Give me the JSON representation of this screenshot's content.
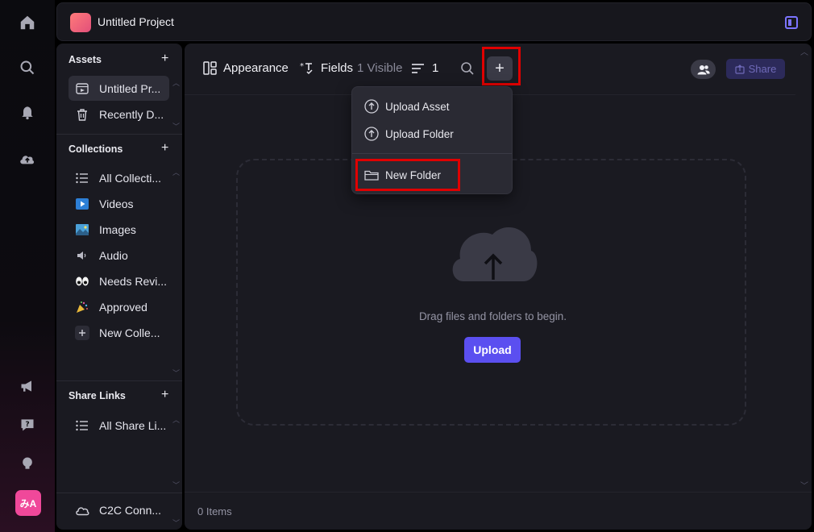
{
  "rail": {
    "icons": [
      "home-icon",
      "search-icon",
      "bell-icon",
      "cloud-upload-icon",
      "megaphone-icon",
      "help-icon",
      "lightbulb-icon"
    ],
    "avatar_text": "みA"
  },
  "topbar": {
    "project_title": "Untitled Project"
  },
  "sidebar": {
    "assets": {
      "heading": "Assets",
      "add": "+",
      "items": [
        {
          "label": "Untitled Pr...",
          "icon": "project-icon",
          "active": true
        },
        {
          "label": "Recently D...",
          "icon": "trash-icon"
        }
      ]
    },
    "collections": {
      "heading": "Collections",
      "add": "+",
      "items": [
        {
          "label": "All Collecti...",
          "icon": "list-icon"
        },
        {
          "label": "Videos",
          "icon": "video-icon"
        },
        {
          "label": "Images",
          "icon": "image-icon"
        },
        {
          "label": "Audio",
          "icon": "speaker-icon"
        },
        {
          "label": "Needs Revi...",
          "icon": "eyes-icon"
        },
        {
          "label": "Approved",
          "icon": "party-popper-icon"
        },
        {
          "label": "New Colle...",
          "icon": "plus-icon"
        }
      ]
    },
    "share_links": {
      "heading": "Share Links",
      "add": "+",
      "items": [
        {
          "label": "All Share Li...",
          "icon": "list-icon"
        }
      ]
    },
    "footer": {
      "label": "C2C Conn...",
      "icon": "cloud-icon"
    }
  },
  "toolbar": {
    "appearance": "Appearance",
    "fields": "Fields",
    "fields_visible": "1 Visible",
    "sort_count": "1",
    "plus": "+",
    "share": "Share"
  },
  "menu": {
    "items": [
      {
        "label": "Upload Asset",
        "icon": "upload-circle-icon"
      },
      {
        "label": "Upload Folder",
        "icon": "upload-circle-icon"
      },
      {
        "label": "New Folder",
        "icon": "folder-icon"
      }
    ]
  },
  "dropzone": {
    "text": "Drag files and folders to begin.",
    "button": "Upload"
  },
  "footer": {
    "items_count": "0 Items"
  },
  "colors": {
    "accent": "#5b4ff0",
    "highlight": "#e00000",
    "avatar": "#f0489a"
  }
}
